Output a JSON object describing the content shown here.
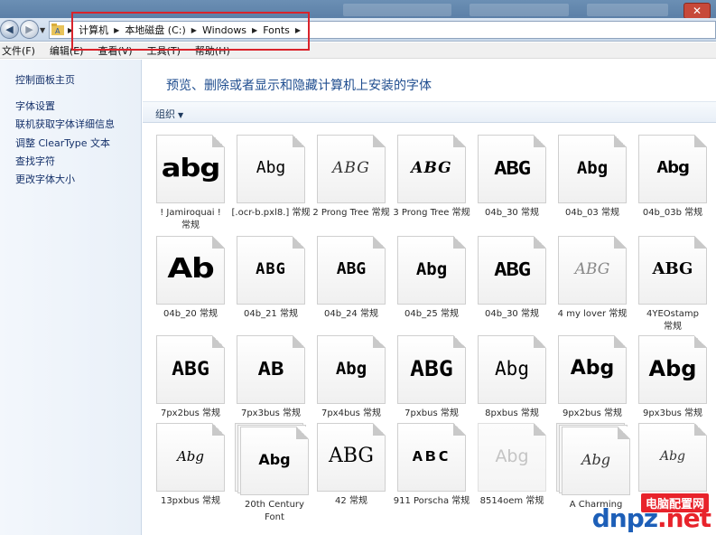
{
  "address": {
    "crumbs": [
      "计算机",
      "本地磁盘 (C:)",
      "Windows",
      "Fonts"
    ]
  },
  "menu": [
    "文件(F)",
    "编辑(E)",
    "查看(V)",
    "工具(T)",
    "帮助(H)"
  ],
  "sidebar": {
    "items": [
      "控制面板主页",
      "字体设置",
      "联机获取字体详细信息",
      "调整 ClearType 文本",
      "查找字符",
      "更改字体大小"
    ]
  },
  "main": {
    "headline": "预览、删除或者显示和隐藏计算机上安装的字体",
    "organize": "组织"
  },
  "fonts": [
    {
      "sample": "abg",
      "line1": "! Jamiroquai !",
      "line2": "常规"
    },
    {
      "sample": "Abg",
      "line1": "[.ocr-b.pxl8.]",
      "line2": "常规"
    },
    {
      "sample": "ABG",
      "line1": "2 Prong Tree",
      "line2": "常规"
    },
    {
      "sample": "ABG",
      "line1": "3 Prong Tree",
      "line2": "常规"
    },
    {
      "sample": "ABG",
      "line1": "04b_30",
      "line2": "常规"
    },
    {
      "sample": "Abg",
      "line1": "04b_03",
      "line2": "常规"
    },
    {
      "sample": "Abg",
      "line1": "04b_03b",
      "line2": "常规"
    },
    {
      "sample": "Ab",
      "line1": "04b_20",
      "line2": "常规"
    },
    {
      "sample": "ABG",
      "line1": "04b_21",
      "line2": "常规"
    },
    {
      "sample": "ABG",
      "line1": "04b_24",
      "line2": "常规"
    },
    {
      "sample": "Abg",
      "line1": "04b_25",
      "line2": "常规"
    },
    {
      "sample": "ABG",
      "line1": "04b_30",
      "line2": "常规"
    },
    {
      "sample": "ABG",
      "line1": "4 my lover",
      "line2": "常规"
    },
    {
      "sample": "ABG",
      "line1": "4YEOstamp",
      "line2": "常规"
    },
    {
      "sample": "ABG",
      "line1": "7px2bus",
      "line2": "常规"
    },
    {
      "sample": "AB",
      "line1": "7px3bus",
      "line2": "常规"
    },
    {
      "sample": "Abg",
      "line1": "7px4bus",
      "line2": "常规"
    },
    {
      "sample": "ABG",
      "line1": "7pxbus",
      "line2": "常规"
    },
    {
      "sample": "Abg",
      "line1": "8pxbus",
      "line2": "常规"
    },
    {
      "sample": "Abg",
      "line1": "9px2bus",
      "line2": "常规"
    },
    {
      "sample": "Abg",
      "line1": "9px3bus",
      "line2": "常规"
    },
    {
      "sample": "Abg",
      "line1": "13pxbus",
      "line2": "常规"
    },
    {
      "sample": "Abg",
      "line1": "20th Century",
      "line2": "Font"
    },
    {
      "sample": "ABG",
      "line1": "42",
      "line2": "常规"
    },
    {
      "sample": "ABC",
      "line1": "911 Porscha",
      "line2": "常规"
    },
    {
      "sample": "Abg",
      "line1": "8514oem",
      "line2": "常规"
    },
    {
      "sample": "Abg",
      "line1": "A Charming",
      "line2": ""
    },
    {
      "sample": "Abg",
      "line1": "",
      "line2": ""
    }
  ],
  "watermark": {
    "top": "电脑配置网",
    "logo_a": "dnpz",
    "logo_b": ".net"
  }
}
